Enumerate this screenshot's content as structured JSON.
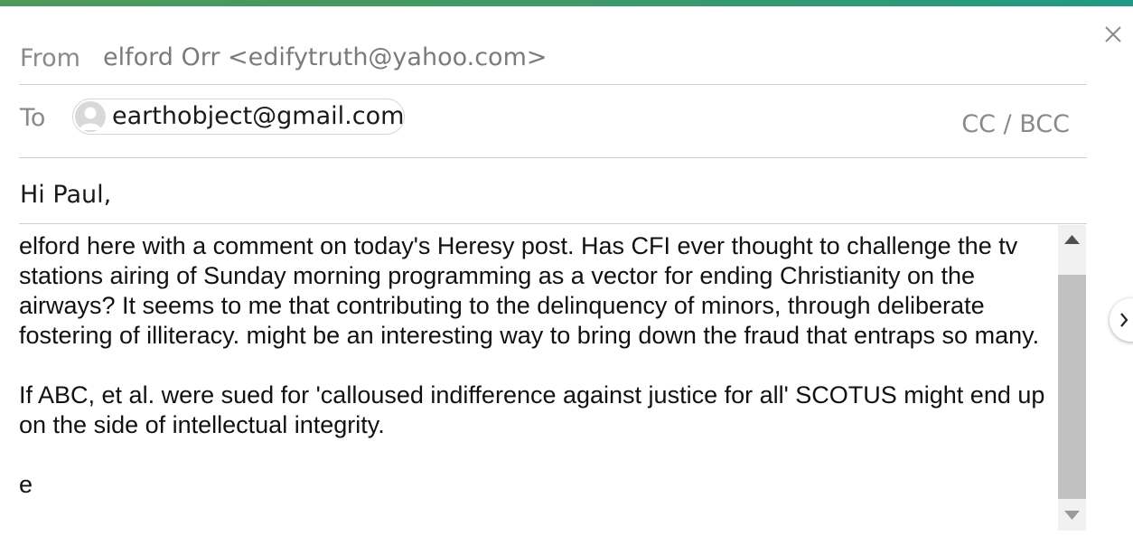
{
  "header": {
    "from_label": "From",
    "from_value": "elford Orr <edifytruth@yahoo.com>",
    "to_label": "To",
    "to_recipient": "earthobject@gmail.com",
    "cc_bcc_label": "CC / BCC"
  },
  "message": {
    "greeting": "Hi Paul,",
    "paragraphs": [
      "elford here with a comment on today's Heresy post. Has CFI ever thought to challenge the tv stations airing of Sunday morning programming as a vector for ending Christianity on the airways? It seems to me that contributing to the delinquency of minors, through deliberate fostering of illiteracy. might be an interesting way to bring down the fraud that entraps so many.",
      "If ABC, et al. were sued for 'calloused indifference against justice for all' SCOTUS might end up on the side of intellectual integrity.",
      "e"
    ]
  },
  "icons": {
    "close": "close-icon",
    "avatar": "person-avatar-icon",
    "scroll_up": "triangle-up-icon",
    "scroll_down": "triangle-down-icon",
    "next": "chevron-right-icon"
  },
  "colors": {
    "accent_start": "#4d9a5a",
    "accent_end": "#1f9a86"
  }
}
